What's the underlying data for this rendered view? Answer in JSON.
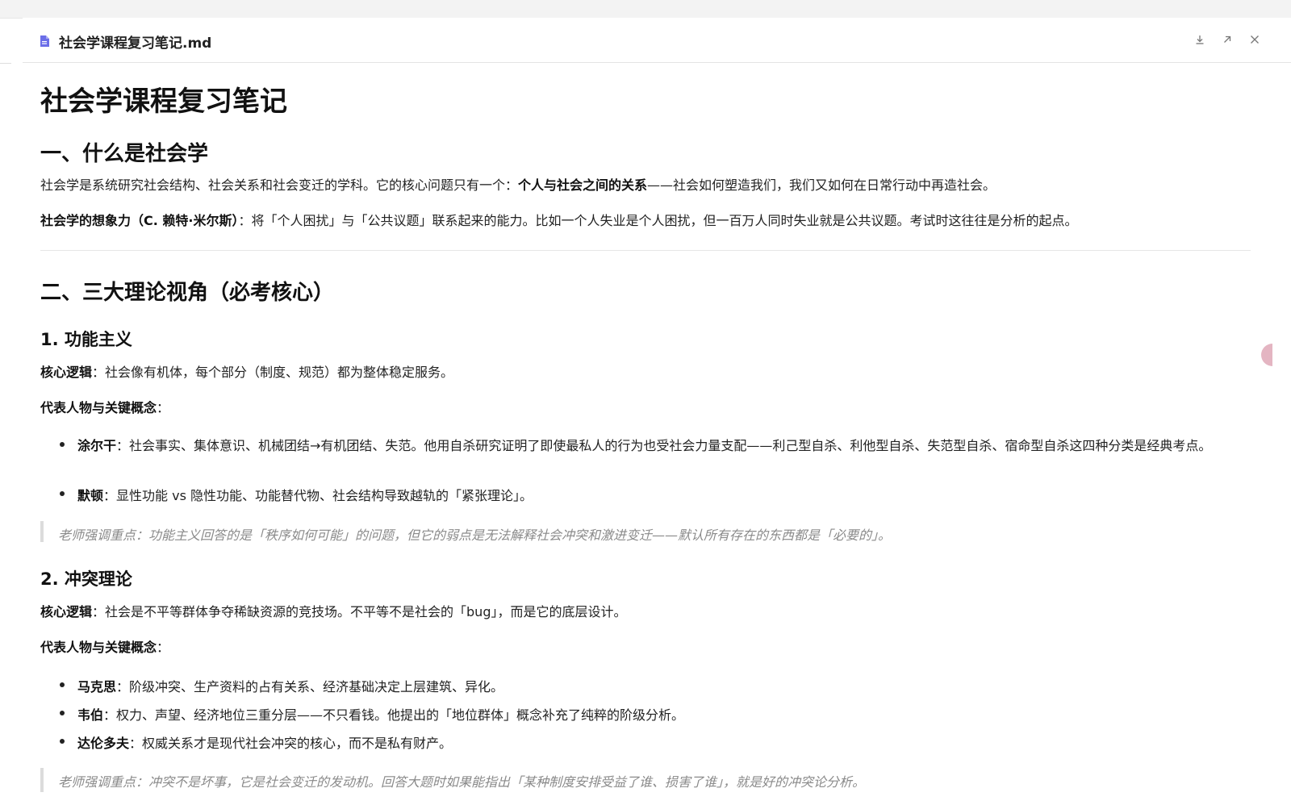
{
  "tab": {
    "file_name": "社会学课程复习笔记.md"
  },
  "toolbar": {
    "download_icon": "download-icon",
    "open_external_icon": "open-external-icon",
    "close_icon": "close-icon"
  },
  "doc": {
    "title": "社会学课程复习笔记",
    "s1": {
      "heading": "一、什么是社会学",
      "p1_a": "社会学是系统研究社会结构、社会关系和社会变迁的学科。它的核心问题只有一个：",
      "p1_bold": "个人与社会之间的关系",
      "p1_b": "——社会如何塑造我们，我们又如何在日常行动中再造社会。",
      "p2_bold": "社会学的想象力（C. 赖特·米尔斯）",
      "p2_rest": "：将「个人困扰」与「公共议题」联系起来的能力。比如一个人失业是个人困扰，但一百万人同时失业就是公共议题。考试时这往往是分析的起点。"
    },
    "s2": {
      "heading": "二、三大理论视角（必考核心）",
      "func": {
        "heading": "1. 功能主义",
        "logic_label": "核心逻辑",
        "logic_text": "：社会像有机体，每个部分（制度、规范）都为整体稳定服务。",
        "figures_label": "代表人物与关键概念",
        "figures_colon": "：",
        "items": [
          {
            "name": "涂尔干",
            "text": "：社会事实、集体意识、机械团结→有机团结、失范。他用自杀研究证明了即使最私人的行为也受社会力量支配——利己型自杀、利他型自杀、失范型自杀、宿命型自杀这四种分类是经典考点。"
          },
          {
            "name": "默顿",
            "text": "：显性功能 vs 隐性功能、功能替代物、社会结构导致越轨的「紧张理论」。"
          }
        ],
        "quote": "老师强调重点：功能主义回答的是「秩序如何可能」的问题，但它的弱点是无法解释社会冲突和激进变迁——默认所有存在的东西都是「必要的」。"
      },
      "conflict": {
        "heading": "2. 冲突理论",
        "logic_label": "核心逻辑",
        "logic_text": "：社会是不平等群体争夺稀缺资源的竞技场。不平等不是社会的「bug」，而是它的底层设计。",
        "figures_label": "代表人物与关键概念",
        "figures_colon": "：",
        "items": [
          {
            "name": "马克思",
            "text": "：阶级冲突、生产资料的占有关系、经济基础决定上层建筑、异化。"
          },
          {
            "name": "韦伯",
            "text": "：权力、声望、经济地位三重分层——不只看钱。他提出的「地位群体」概念补充了纯粹的阶级分析。"
          },
          {
            "name": "达伦多夫",
            "text": "：权威关系才是现代社会冲突的核心，而不是私有财产。"
          }
        ],
        "quote": "老师强调重点：冲突不是坏事，它是社会变迁的发动机。回答大题时如果能指出「某种制度安排受益了谁、损害了谁」，就是好的冲突论分析。"
      }
    }
  }
}
